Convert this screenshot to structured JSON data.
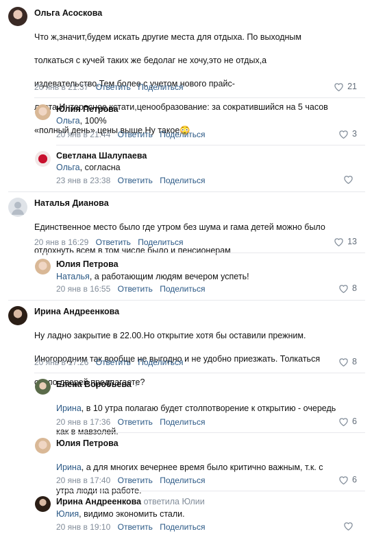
{
  "comments": [
    {
      "name": "Ольга Асоскова",
      "text_lines": [
        "Что ж,значит,будем искать другие места для отдыха. По выходным",
        "толкаться с кучей таких же бедолаг не хочу,это не отдых,а",
        "издевательство.Тем более с учетом нового прайс-",
        "листа.Интересное,кстати,ценообразование: за сократившийся на 5 часов",
        "«полный день» цены выше.Ну такое"
      ],
      "emoji": "😳",
      "date": "20 янв в 21:37",
      "reply_label": "Ответить",
      "share_label": "Поделиться",
      "likes": "21"
    },
    {
      "name": "Юлия Петрова",
      "addressee": "Ольга",
      "text": ", 100%",
      "date": "20 янв в 21:44",
      "reply_label": "Ответить",
      "share_label": "Поделиться",
      "likes": "3"
    },
    {
      "name": "Светлана Шалупаева",
      "addressee": "Ольга",
      "text": ", согласна",
      "date": "23 янв в 23:38",
      "reply_label": "Ответить",
      "share_label": "Поделиться",
      "likes": ""
    },
    {
      "name": "Наталья Дианова",
      "text_lines": [
        "Единственное место было где утром без шума и гама детей можно было",
        "отдохнуть всем в том числе было и пенсионерам"
      ],
      "date": "20 янв в 16:29",
      "reply_label": "Ответить",
      "share_label": "Поделиться",
      "likes": "13"
    },
    {
      "name": "Юлия Петрова",
      "addressee": "Наталья",
      "text": ", а работающим людям вечером успеть!",
      "date": "20 янв в 16:55",
      "reply_label": "Ответить",
      "share_label": "Поделиться",
      "likes": "8"
    },
    {
      "name": "Ирина Андреенкова",
      "text_lines": [
        "Ну ладно закрытие в 22.00.Но открытие хотя бы оставили прежним.",
        "Иногородним так вообще не выгодно и не удобно приезжать. Толкаться",
        "около дверей предлагаете?"
      ],
      "date": "20 янв в 17:26",
      "reply_label": "Ответить",
      "share_label": "Поделиться",
      "likes": "8"
    },
    {
      "name": "Елена Воробьева",
      "addressee": "Ирина",
      "text_line1": ", в 10 утра полагаю будет столпотворение к открытию - очередь",
      "text_line2": "как в мавзолей.",
      "date": "20 янв в 17:36",
      "reply_label": "Ответить",
      "share_label": "Поделиться",
      "likes": "6"
    },
    {
      "name": "Юлия Петрова",
      "addressee": "Ирина",
      "text_line1": ", а для многих вечернее время было критично важным, т.к. с",
      "text_line2": "утра люди на работе.",
      "date": "20 янв в 17:40",
      "reply_label": "Ответить",
      "share_label": "Поделиться",
      "likes": "6"
    },
    {
      "name": "Ирина Андреенкова",
      "replied_to": "ответила Юлии",
      "addressee": "Юлия",
      "text": ", видимо экономить стали.",
      "date": "20 янв в 19:10",
      "reply_label": "Ответить",
      "share_label": "Поделиться",
      "likes": ""
    }
  ],
  "colors": {
    "link": "#2a5885",
    "meta": "#818c99",
    "separator": "#e7e8ec"
  },
  "icons": [
    "heart-icon",
    "verified-check-icon"
  ]
}
